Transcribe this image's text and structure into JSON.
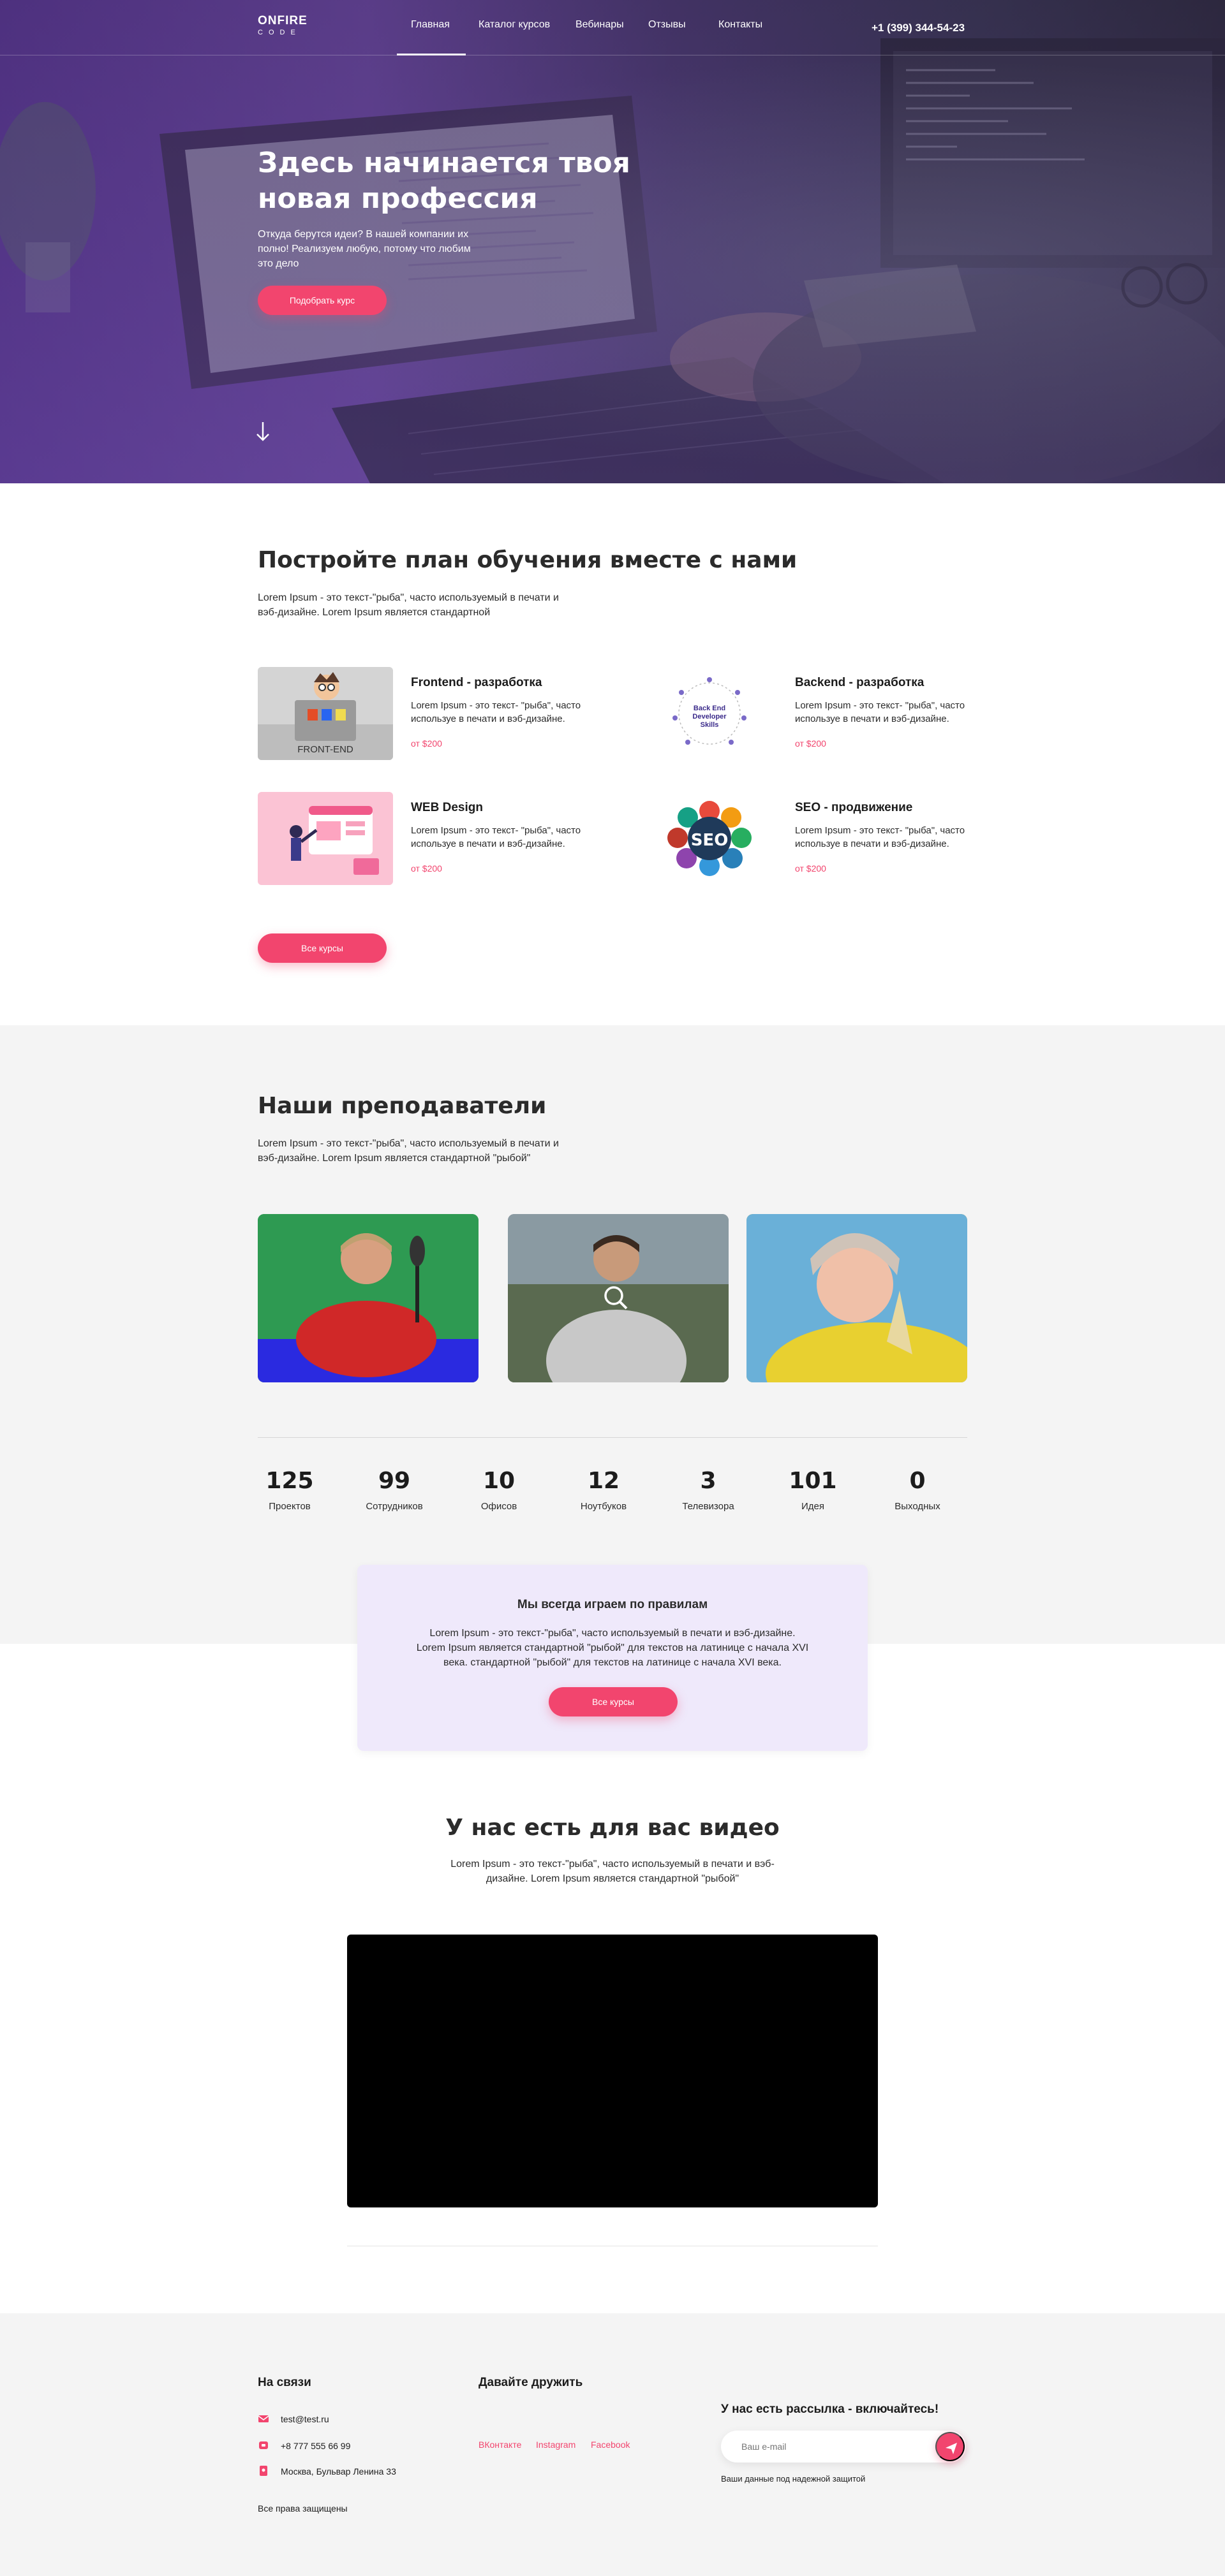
{
  "header": {
    "logo_top": "ONFIRE",
    "logo_bottom": "CODE",
    "nav": [
      "Главная",
      "Каталог курсов",
      "Вебинары",
      "Отзывы",
      "Контакты"
    ],
    "active_nav": "Главная",
    "phone": "+1 (399) 344-54-23"
  },
  "hero": {
    "title_line1": "Здесь начинается твоя",
    "title_line2": "новая профессия",
    "subtitle": "Откуда берутся идеи? В нашей компании их полно! Реализуем любую, потому что любим это дело",
    "cta": "Подобрать курс",
    "scroll_icon": "arrow-down-icon"
  },
  "courses": {
    "title": "Постройте план обучения вместе с нами",
    "lead": "Lorem Ipsum - это текст-\"рыба\", часто используемый в печати и вэб-дизайне. Lorem Ipsum является стандартной",
    "items": [
      {
        "title": "Frontend - разработка",
        "desc": "Lorem Ipsum - это текст- \"рыба\", часто используе в печати и вэб-дизайне.",
        "price": "от $200",
        "img_text": "FRONT-END"
      },
      {
        "title": "Backend - разработка",
        "desc": "Lorem Ipsum - это текст- \"рыба\", часто используе в печати и вэб-дизайне.",
        "price": "от $200",
        "img_text": "Back End Developer Skills"
      },
      {
        "title": "WEB Design",
        "desc": "Lorem Ipsum - это текст- \"рыба\", часто используе в печати и вэб-дизайне.",
        "price": "от $200",
        "img_text": ""
      },
      {
        "title": "SEO - продвижение",
        "desc": "Lorem Ipsum - это текст- \"рыба\", часто используе в печати и вэб-дизайне.",
        "price": "от $200",
        "img_text": "SEO"
      }
    ],
    "all_button": "Все курсы"
  },
  "teachers": {
    "title": "Наши преподаватели",
    "lead": "Lorem Ipsum - это текст-\"рыба\", часто используемый в печати и вэб-дизайне. Lorem Ipsum является стандартной \"рыбой\"",
    "zoom_icon": "search-icon"
  },
  "stats": [
    {
      "value": "125",
      "label": "Проектов"
    },
    {
      "value": "99",
      "label": "Сотрудников"
    },
    {
      "value": "10",
      "label": "Офисов"
    },
    {
      "value": "12",
      "label": "Ноутбуков"
    },
    {
      "value": "3",
      "label": "Телевизора"
    },
    {
      "value": "101",
      "label": "Идея"
    },
    {
      "value": "0",
      "label": "Выходных"
    }
  ],
  "rules": {
    "title": "Мы всегда играем по правилам",
    "text": "Lorem Ipsum - это текст-\"рыба\", часто используемый в печати и вэб-дизайне. Lorem Ipsum является стандартной \"рыбой\" для текстов на латинице с начала XVI века.  стандартной \"рыбой\" для текстов на латинице с начала XVI века.",
    "button": "Все курсы"
  },
  "video": {
    "title": "У нас есть для вас видео",
    "lead": "Lorem Ipsum - это текст-\"рыба\", часто используемый в печати и вэб-дизайне. Lorem Ipsum является стандартной \"рыбой\""
  },
  "footer": {
    "contacts_title": "На связи",
    "email": "test@test.ru",
    "phone": "+8 777 555 66 99",
    "address": "Москва, Бульвар Ленина 33",
    "rights": "Все права защищены",
    "social_title": "Давайте дружить",
    "social_links": [
      "ВКонтакте",
      "Instagram",
      "Facebook"
    ],
    "subscribe_title": "У нас есть рассылка - включайтесь!",
    "email_placeholder": "Ваш e-mail",
    "privacy": "Ваши данные под надежной защитой"
  },
  "colors": {
    "accent": "#f2456e",
    "hero_purple": "#5a3a8e",
    "rules_bg": "#efe9fb",
    "section_gray": "#f4f4f4"
  }
}
